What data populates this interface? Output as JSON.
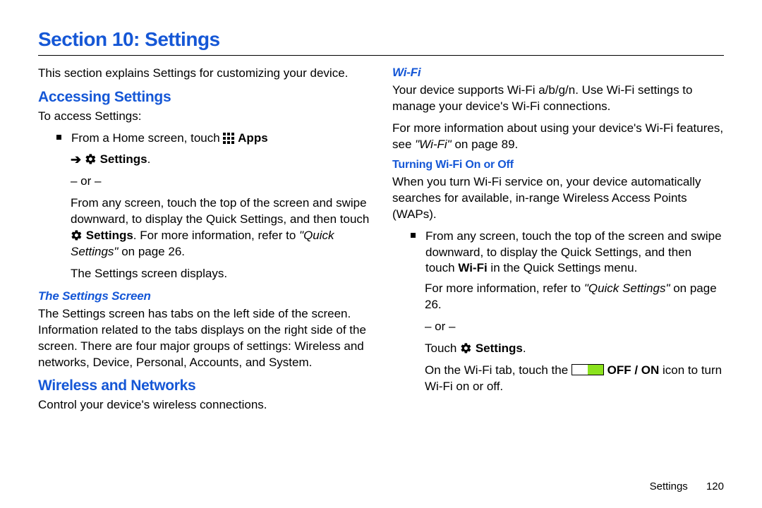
{
  "title": "Section 10: Settings",
  "col1": {
    "intro": "This section explains Settings for customizing your device.",
    "h_access": "Accessing Settings",
    "to_access": "To access Settings:",
    "b1_a": "From a Home screen, touch ",
    "b1_apps": " Apps",
    "b1_settings": " Settings",
    "b1_period": ".",
    "or": "– or –",
    "b1_from_any": "From any screen, touch the top of the screen and swipe downward, to display the Quick Settings, and then touch ",
    "b1_settings2": " Settings",
    "b1_more": ". For more information, refer to ",
    "b1_qs": "\"Quick Settings\" ",
    "b1_page": "on page 26.",
    "b1_screen": "The Settings screen displays.",
    "h_screen": "The Settings Screen",
    "screen_text": "The Settings screen has tabs on the left side of the screen. Information related to the tabs displays on the right side of the screen. There are four major groups of settings: Wireless and networks, Device, Personal, Accounts, and System.",
    "h_wireless": "Wireless and Networks",
    "wireless_text": "Control your device's wireless connections."
  },
  "col2": {
    "h_wifi": "Wi-Fi",
    "wifi_p1_a": "Your device supports Wi-Fi a/b/g/n. Use Wi-Fi settings to manage your device's Wi-Fi connections.",
    "wifi_p2_a": "For more information about using your device's Wi-Fi features, see ",
    "wifi_p2_i": "\"Wi-Fi\" ",
    "wifi_p2_b": "on page 89.",
    "h_onoff": "Turning Wi-Fi On or Off",
    "onoff_p1": "When you turn Wi-Fi service on, your device automatically searches for available, in-range Wireless Access Points (WAPs).",
    "b_from_any": "From any screen, touch the top of the screen and swipe downward, to display the Quick Settings, and then touch ",
    "b_wifi": "Wi-Fi",
    "b_in_qs": " in the Quick Settings menu.",
    "b_more": "For more information, refer to ",
    "b_qs": "\"Quick Settings\"",
    "b_page": " on page 26.",
    "or": "– or –",
    "touch": "Touch ",
    "settings": " Settings",
    "period": ".",
    "tab_a": "On the Wi-Fi tab, touch the ",
    "tab_b": " OFF / ON",
    "tab_c": " icon to turn Wi-Fi on or off."
  },
  "footer": {
    "label": "Settings",
    "page": "120"
  }
}
